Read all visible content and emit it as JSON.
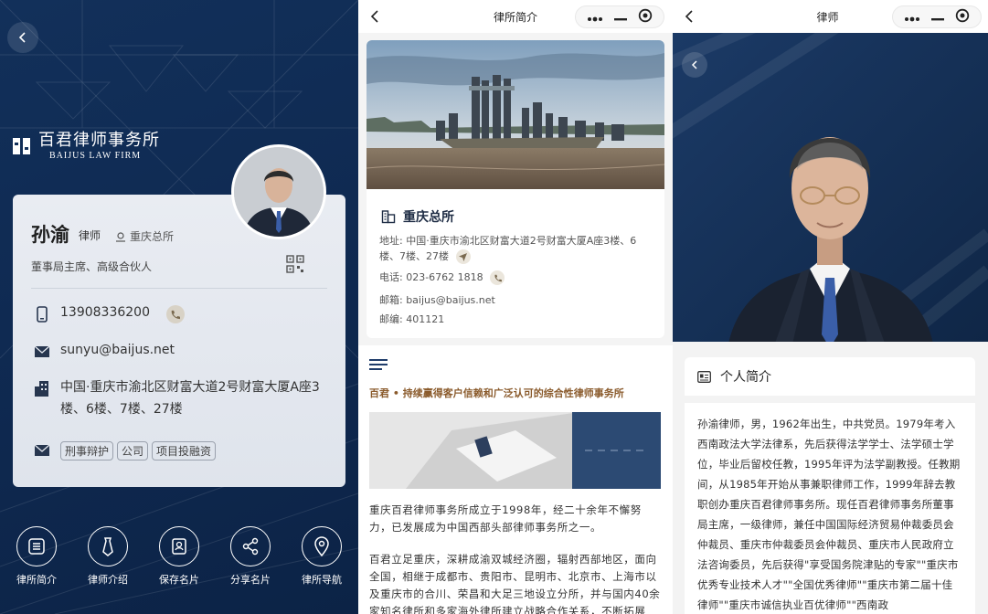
{
  "card_page": {
    "firm_logo": {
      "cn": "百君律师事务所",
      "en": "BAIJUS LAW FIRM"
    },
    "name": "孙渝",
    "title": "律师",
    "office": "重庆总所",
    "position": "董事局主席、高级合伙人",
    "phone": "13908336200",
    "email": "sunyu@baijus.net",
    "address": "中国·重庆市渝北区财富大道2号财富大厦A座3楼、6楼、7楼、27楼",
    "practice_tags": [
      "刑事辩护",
      "公司",
      "项目投融资"
    ],
    "nav": [
      {
        "label": "律所简介",
        "icon": "list-icon"
      },
      {
        "label": "律师介绍",
        "icon": "tie-icon"
      },
      {
        "label": "保存名片",
        "icon": "contact-card-icon"
      },
      {
        "label": "分享名片",
        "icon": "share-icon"
      },
      {
        "label": "律所导航",
        "icon": "location-pin-icon"
      }
    ]
  },
  "firm_page": {
    "topbar_title": "律所简介",
    "office_name": "重庆总所",
    "address_line": "地址: 中国·重庆市渝北区财富大道2号财富大厦A座3楼、6楼、7楼、27楼",
    "phone_line": "电话: 023-6762 1818",
    "email_line": "邮箱: baijus@baijus.net",
    "postcode_line": "邮编: 401121",
    "headline": "百君 • 持续赢得客户信赖和广泛认可的综合性律师事务所",
    "para1": "重庆百君律师事务所成立于1998年，经二十余年不懈努力，已发展成为中国西部头部律师事务所之一。",
    "para2": "百君立足重庆，深耕成渝双城经济圈，辐射西部地区，面向全国，相继于成都市、贵阳市、昆明市、北京市、上海市以及重庆市的合川、荣昌和大足三地设立分所，并与国内40余家知名律所和多家海外律所建立战略合作关系，不断拓展"
  },
  "lawyer_page": {
    "topbar_title": "律师",
    "bio_heading": "个人简介",
    "bio": "孙渝律师，男，1962年出生，中共党员。1979年考入西南政法大学法律系，先后获得法学学士、法学硕士学位，毕业后留校任教，1995年评为法学副教授。任教期间，从1985年开始从事兼职律师工作，1999年辞去教职创办重庆百君律师事务所。现任百君律师事务所董事局主席，一级律师，兼任中国国际经济贸易仲裁委员会仲裁员、重庆市仲裁委员会仲裁员、重庆市人民政府立法咨询委员，先后获得\"享受国务院津贴的专家\"\"重庆市优秀专业技术人才\"\"全国优秀律师\"\"重庆市第二届十佳律师\"\"重庆市诚信执业百优律师\"\"西南政"
  },
  "colors": {
    "navy": "#12305a",
    "gold_text": "#8a5a2b",
    "card_bg": "#e5e9f0"
  }
}
